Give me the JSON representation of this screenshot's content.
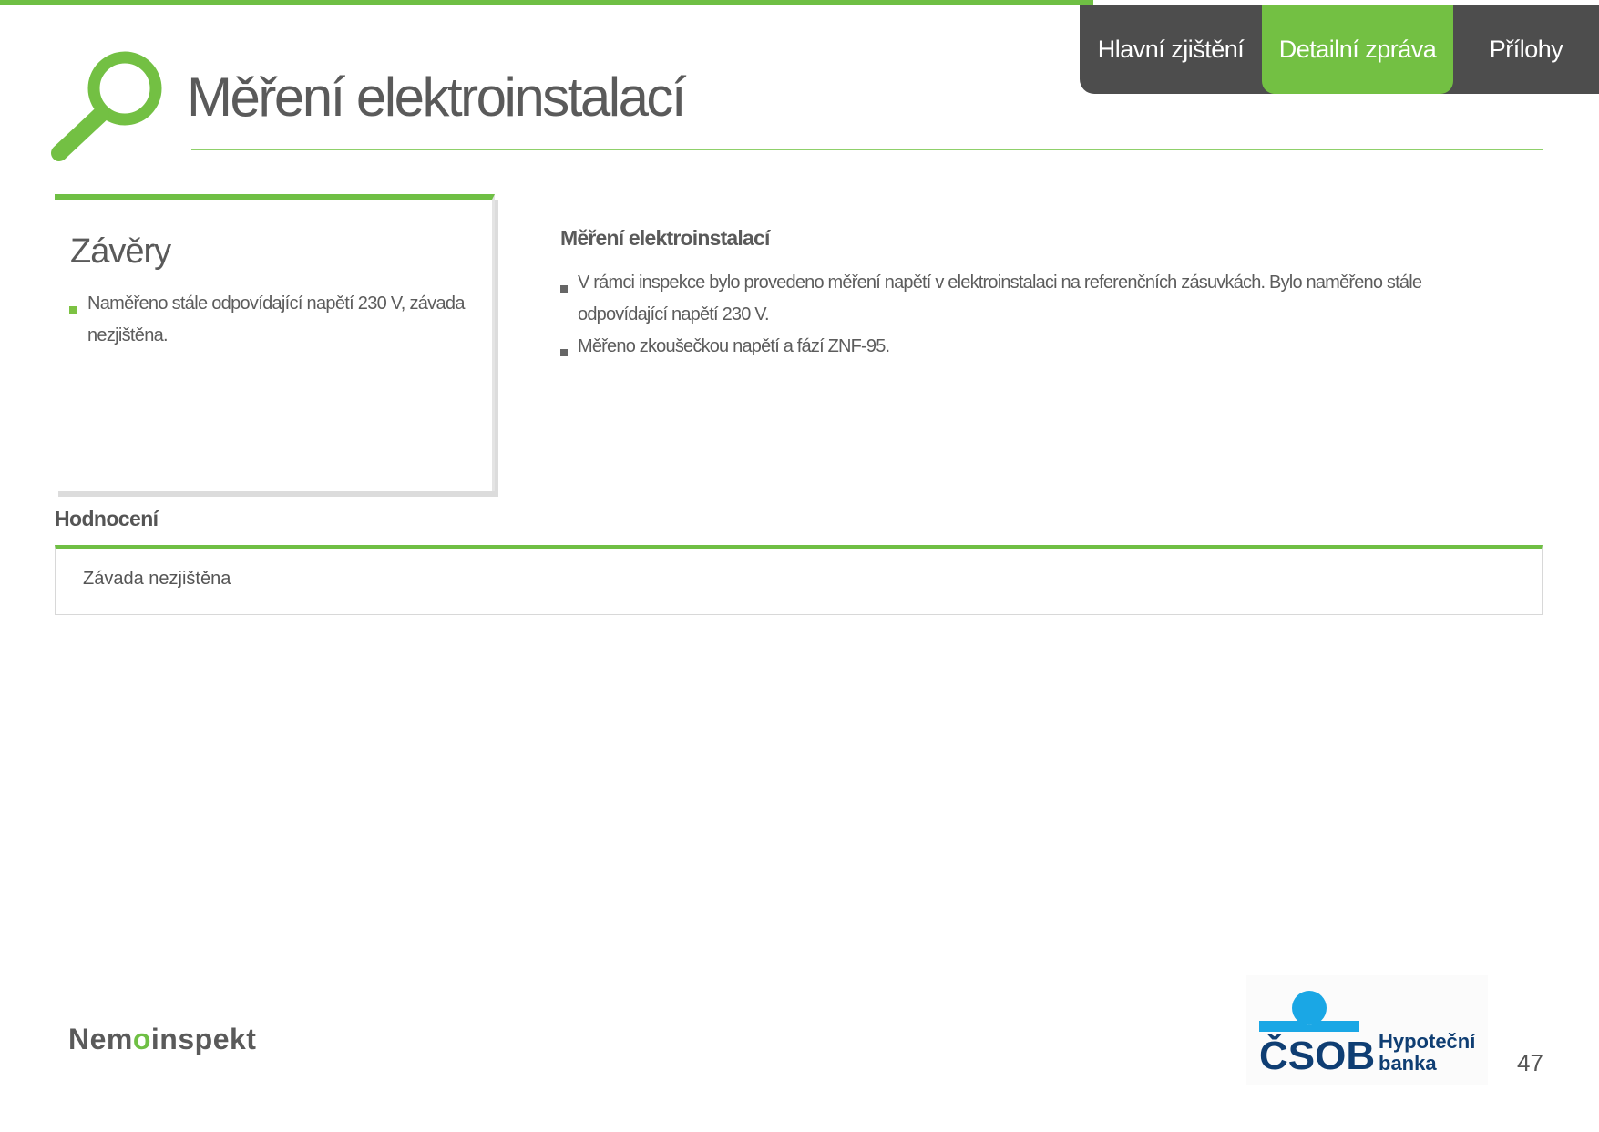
{
  "nav": {
    "tabs": [
      {
        "label": "Hlavní zjištění"
      },
      {
        "label": "Detailní zpráva"
      },
      {
        "label": "Přílohy"
      }
    ],
    "active_tab": "Detailní zpráva",
    "active_color": "#73c043",
    "bar_color": "#4d4d4d"
  },
  "header": {
    "title": "Měření elektroinstalací",
    "icon": "magnifier-icon"
  },
  "conclusions": {
    "heading": "Závěry",
    "items": [
      "Naměřeno stále odpovídající napětí 230 V, závada nezjištěna."
    ]
  },
  "detail": {
    "heading": "Měření elektroinstalací",
    "items": [
      "V rámci inspekce bylo provedeno měření napětí v elektroinstalaci na referenčních zásuvkách. Bylo naměřeno stále odpovídající napětí 230 V.",
      "Měřeno zkoušečkou napětí a fází ZNF-95."
    ]
  },
  "rating": {
    "label": "Hodnocení",
    "value": "Závada nezjištěna"
  },
  "footer": {
    "logo_left_prefix": "Nem",
    "logo_left_o": "o",
    "logo_left_suffix": "inspekt",
    "bank_logo_main": "ČSOB",
    "bank_logo_line1": "Hypoteční",
    "bank_logo_line2": "banka",
    "page_number": "47"
  },
  "accent_color": "#6fbf44"
}
